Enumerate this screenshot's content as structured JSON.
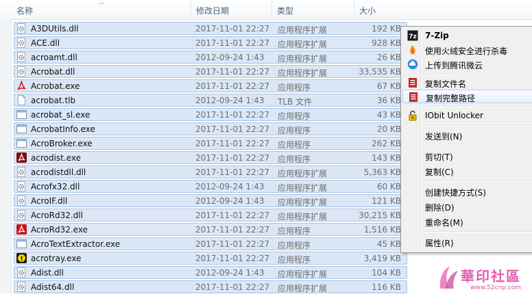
{
  "columns": {
    "name": "名称",
    "date": "修改日期",
    "type": "类型",
    "size": "大小"
  },
  "files": [
    {
      "name": "A3DUtils.dll",
      "date": "2017-11-01 22:27",
      "type": "应用程序扩展",
      "size": "192 KB",
      "icon": "dll-gear-icon"
    },
    {
      "name": "ACE.dll",
      "date": "2017-11-01 22:27",
      "type": "应用程序扩展",
      "size": "928 KB",
      "icon": "dll-gear-icon"
    },
    {
      "name": "acroamt.dll",
      "date": "2012-09-24 1:43",
      "type": "应用程序扩展",
      "size": "26 KB",
      "icon": "dll-gear-icon"
    },
    {
      "name": "Acrobat.dll",
      "date": "2017-11-01 22:27",
      "type": "应用程序扩展",
      "size": "33,535 KB",
      "icon": "dll-gear-icon"
    },
    {
      "name": "Acrobat.exe",
      "date": "2017-11-01 22:27",
      "type": "应用程序",
      "size": "67 KB",
      "icon": "acrobat-icon"
    },
    {
      "name": "acrobat.tlb",
      "date": "2012-09-24 1:43",
      "type": "TLB 文件",
      "size": "36 KB",
      "icon": "blank-file-icon"
    },
    {
      "name": "acrobat_sl.exe",
      "date": "2017-11-01 22:27",
      "type": "应用程序",
      "size": "43 KB",
      "icon": "exe-window-icon"
    },
    {
      "name": "AcrobatInfo.exe",
      "date": "2017-11-01 22:27",
      "type": "应用程序",
      "size": "20 KB",
      "icon": "exe-window-icon"
    },
    {
      "name": "AcroBroker.exe",
      "date": "2017-11-01 22:27",
      "type": "应用程序",
      "size": "262 KB",
      "icon": "exe-window-icon"
    },
    {
      "name": "acrodist.exe",
      "date": "2017-11-01 22:27",
      "type": "应用程序",
      "size": "143 KB",
      "icon": "acrodist-icon"
    },
    {
      "name": "acrodistdll.dll",
      "date": "2017-11-01 22:27",
      "type": "应用程序扩展",
      "size": "5,363 KB",
      "icon": "dll-gear-icon"
    },
    {
      "name": "Acrofx32.dll",
      "date": "2012-09-24 1:43",
      "type": "应用程序扩展",
      "size": "60 KB",
      "icon": "dll-gear-icon"
    },
    {
      "name": "AcroIF.dll",
      "date": "2012-09-24 1:43",
      "type": "应用程序扩展",
      "size": "121 KB",
      "icon": "dll-gear-icon"
    },
    {
      "name": "AcroRd32.dll",
      "date": "2017-11-01 22:27",
      "type": "应用程序扩展",
      "size": "30,215 KB",
      "icon": "dll-gear-icon"
    },
    {
      "name": "AcroRd32.exe",
      "date": "2017-11-01 22:27",
      "type": "应用程序",
      "size": "1,516 KB",
      "icon": "acrobat-reader-icon"
    },
    {
      "name": "AcroTextExtractor.exe",
      "date": "2017-11-01 22:27",
      "type": "应用程序",
      "size": "45 KB",
      "icon": "exe-window-icon"
    },
    {
      "name": "acrotray.exe",
      "date": "2017-11-01 22:27",
      "type": "应用程序",
      "size": "3,419 KB",
      "icon": "acrotray-icon"
    },
    {
      "name": "Adist.dll",
      "date": "2012-09-24 1:43",
      "type": "应用程序扩展",
      "size": "104 KB",
      "icon": "dll-gear-icon"
    },
    {
      "name": "Adist64.dll",
      "date": "2017-11-01 22:27",
      "type": "应用程序扩展",
      "size": "116 KB",
      "icon": "dll-gear-icon"
    }
  ],
  "context_menu": {
    "items": [
      {
        "label": "7-Zip",
        "icon": "7zip-icon",
        "bold": true
      },
      {
        "label": "使用火绒安全进行杀毒",
        "icon": "huorong-icon"
      },
      {
        "label": "上传到腾讯微云",
        "icon": "weiyun-icon"
      },
      {
        "label": "复制文件名",
        "icon": "copy-red-icon"
      },
      {
        "label": "复制完整路径",
        "icon": "copy-red-icon",
        "highlighted": true
      },
      {
        "label": "IObit Unlocker",
        "icon": "iobit-lock-icon"
      },
      {
        "label": "发送到(N)",
        "icon": ""
      },
      {
        "label": "剪切(T)",
        "icon": ""
      },
      {
        "label": "复制(C)",
        "icon": ""
      },
      {
        "label": "创建快捷方式(S)",
        "icon": ""
      },
      {
        "label": "删除(D)",
        "icon": ""
      },
      {
        "label": "重命名(M)",
        "icon": ""
      },
      {
        "label": "属性(R)",
        "icon": ""
      }
    ]
  },
  "watermark": {
    "text": "華印社區",
    "url": "www.52cnp.com"
  }
}
